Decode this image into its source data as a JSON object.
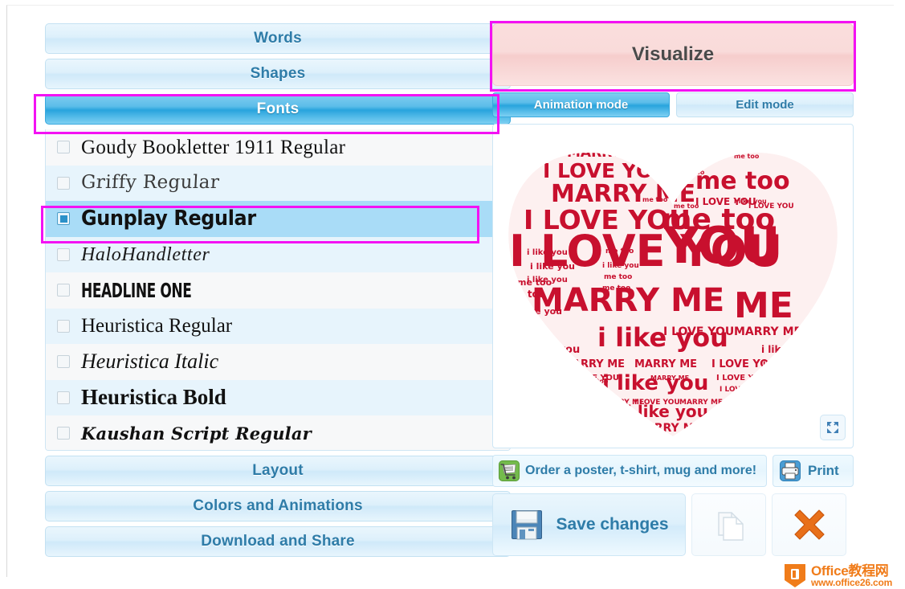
{
  "left_panel": {
    "sections_top": [
      {
        "label": "Words",
        "active": false
      },
      {
        "label": "Shapes",
        "active": false
      },
      {
        "label": "Fonts",
        "active": true
      }
    ],
    "sections_bottom": [
      {
        "label": "Layout",
        "active": false
      },
      {
        "label": "Colors and Animations",
        "active": false
      },
      {
        "label": "Download and Share",
        "active": false
      }
    ],
    "font_list": [
      {
        "name": "Goudy Bookletter 1911 Regular",
        "checked": false,
        "style": "f-goudy"
      },
      {
        "name": "Griffy Regular",
        "checked": false,
        "style": "f-griffy"
      },
      {
        "name": "Gunplay Regular",
        "checked": true,
        "style": "f-gunplay"
      },
      {
        "name": "HaloHandletter",
        "checked": false,
        "style": "f-halo"
      },
      {
        "name": "HEADLINE ONE",
        "checked": false,
        "style": "f-headline"
      },
      {
        "name": "Heuristica Regular",
        "checked": false,
        "style": "f-heur"
      },
      {
        "name": "Heuristica Italic",
        "checked": false,
        "style": "f-heur-i"
      },
      {
        "name": "Heuristica Bold",
        "checked": false,
        "style": "f-heur-b"
      },
      {
        "name": "Kaushan Script Regular",
        "checked": false,
        "style": "f-kaushan"
      }
    ]
  },
  "right_panel": {
    "visualize_label": "Visualize",
    "modes": [
      {
        "label": "Animation mode",
        "active": true
      },
      {
        "label": "Edit mode",
        "active": false
      }
    ],
    "order_label": "Order a poster, t-shirt, mug and more!",
    "print_label": "Print",
    "save_label": "Save changes",
    "fullscreen_icon": "fullscreen-icon",
    "copy_icon": "copy-documents-icon",
    "delete_icon": "delete-x-icon"
  },
  "word_cloud": {
    "shape": "heart",
    "phrases": [
      "I LOVE YOU",
      "MARRY ME",
      "me too",
      "i like you"
    ],
    "color": "#c8102e",
    "background": "#ffffff"
  },
  "colors": {
    "accent_blue": "#28a4dd",
    "panel_text_blue": "#2e7ca8",
    "highlight_magenta": "#f312f3",
    "visualize_pink": "#f6cdcc",
    "cloud_red": "#c8102e",
    "watermark_orange": "#f07c1a"
  },
  "watermark": {
    "line1": "Office教程网",
    "line2": "www.office26.com"
  }
}
